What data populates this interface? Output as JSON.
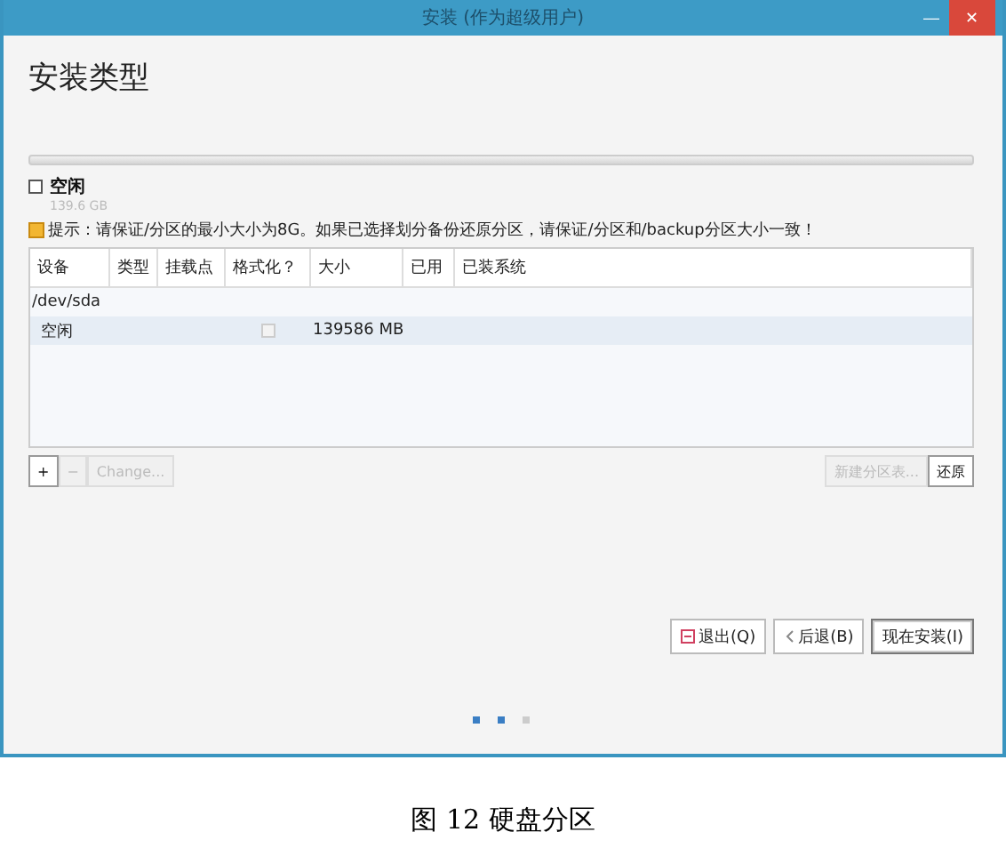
{
  "window": {
    "title": "安装 (作为超级用户)",
    "minimize": "—",
    "close": "✕"
  },
  "heading": "安装类型",
  "legend": {
    "label": "空闲",
    "size": "139.6 GB",
    "checked": false
  },
  "hint": "提示：请保证/分区的最小大小为8G。如果已选择划分备份还原分区，请保证/分区和/backup分区大小一致！",
  "table": {
    "columns": [
      "设备",
      "类型",
      "挂载点",
      "格式化？",
      "大小",
      "已用",
      "已装系统"
    ],
    "rows": [
      {
        "kind": "device",
        "device": "/dev/sda",
        "selected": false
      },
      {
        "kind": "partition",
        "device": "空闲",
        "format": false,
        "size": "139586 MB",
        "selected": true
      }
    ]
  },
  "partition_buttons": [
    {
      "label": "+",
      "disabled": false
    },
    {
      "label": "−",
      "disabled": true
    },
    {
      "label": "Change...",
      "disabled": true
    }
  ],
  "table_buttons": [
    {
      "label": "新建分区表...",
      "disabled": true
    },
    {
      "label": "还原",
      "disabled": false
    }
  ],
  "actions": [
    {
      "label": "退出(Q)",
      "kind": "quit",
      "default": false
    },
    {
      "label": "后退(B)",
      "kind": "back",
      "default": false
    },
    {
      "label": "现在安装(I)",
      "kind": "install",
      "default": true
    }
  ],
  "steps": [
    {
      "selected": true
    },
    {
      "selected": true
    },
    {
      "selected": false
    }
  ],
  "caption": "图  12 硬盘分区"
}
